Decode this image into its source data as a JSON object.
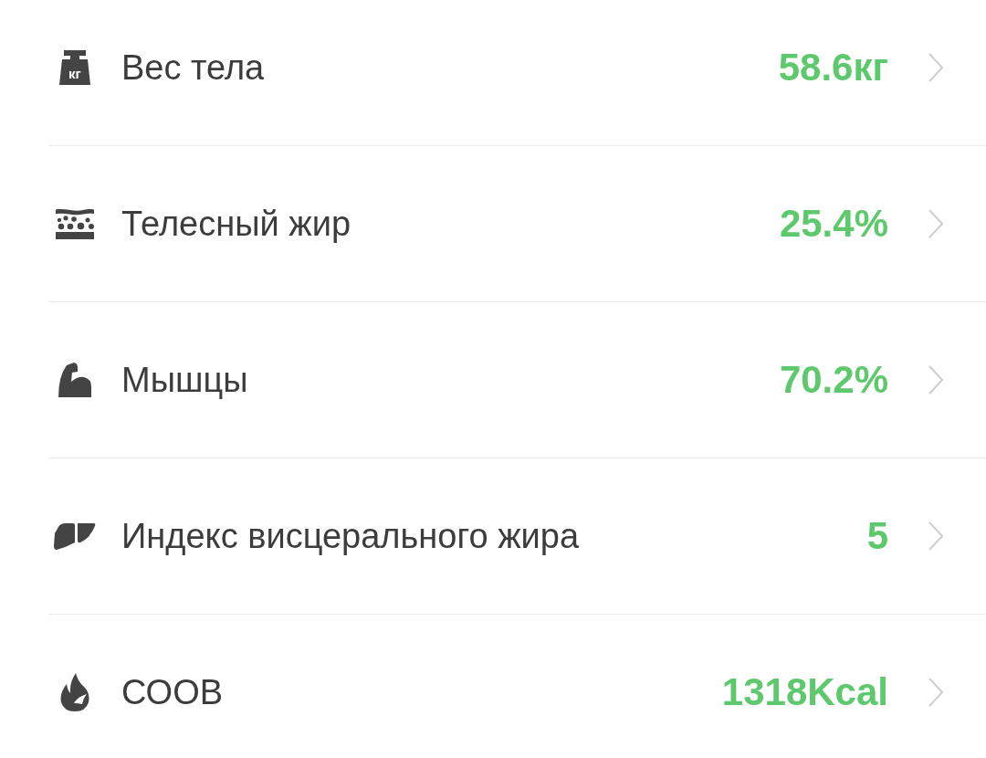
{
  "metrics": [
    {
      "kind": "weight",
      "icon_text": "кг",
      "label": "Вес тела",
      "value": "58.6кг"
    },
    {
      "kind": "body_fat",
      "label": "Телесный жир",
      "value": "25.4%"
    },
    {
      "kind": "muscle",
      "label": "Мышцы",
      "value": "70.2%"
    },
    {
      "kind": "visceral_fat",
      "label": "Индекс висцерального жира",
      "value": "5"
    },
    {
      "kind": "bmr",
      "label": "СООВ",
      "value": "1318Kcal"
    }
  ]
}
